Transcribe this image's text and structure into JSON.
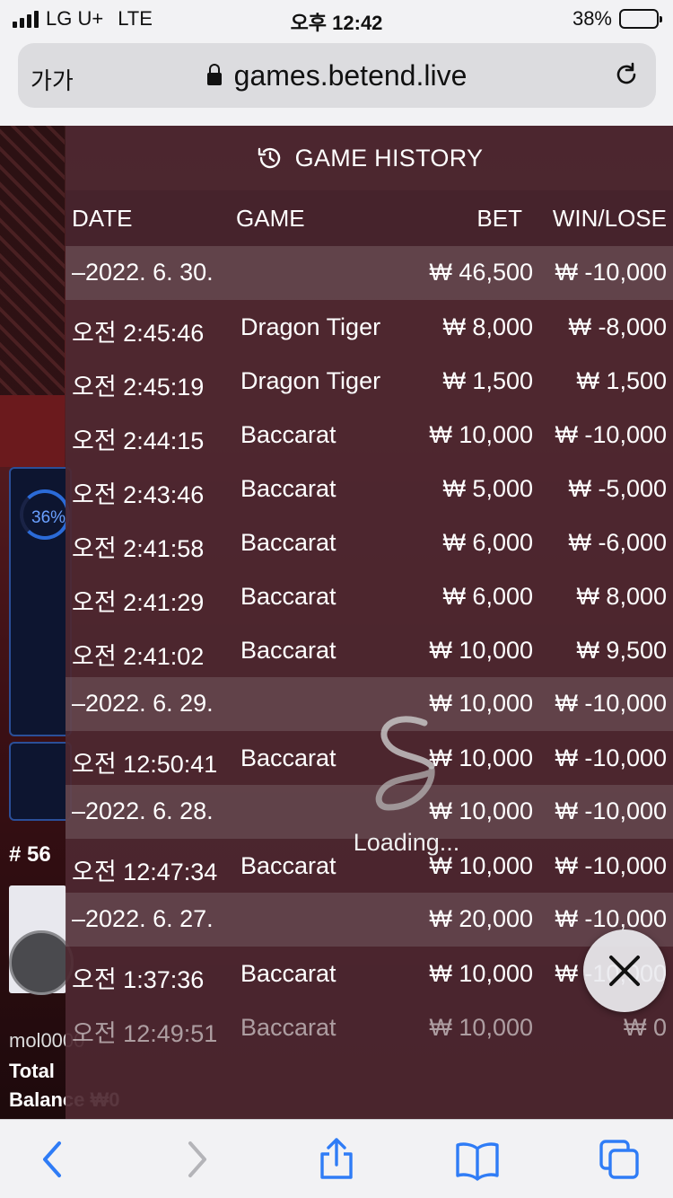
{
  "status_bar": {
    "carrier": "LG U+",
    "network": "LTE",
    "time": "오후 12:42",
    "battery": "38%",
    "battery_level": 0.38
  },
  "address_bar": {
    "text_size_label": "가가",
    "url": "games.betend.live"
  },
  "background": {
    "progress_label": "36%",
    "round_label": "# 56",
    "username": "mol0000",
    "total_label": "Total",
    "balance_label": "Balance ₩0"
  },
  "history": {
    "title": "GAME HISTORY",
    "columns": {
      "date": "DATE",
      "game": "GAME",
      "bet": "BET",
      "win_lose": "WIN/LOSE"
    },
    "rows": [
      {
        "type": "group",
        "date": "–2022. 6. 30.",
        "game": "",
        "bet": "₩ 46,500",
        "win_lose": "₩ -10,000"
      },
      {
        "type": "item",
        "date": "오전 2:45:46",
        "game": "Dragon Tiger",
        "bet": "₩ 8,000",
        "win_lose": "₩ -8,000"
      },
      {
        "type": "item",
        "date": "오전 2:45:19",
        "game": "Dragon Tiger",
        "bet": "₩ 1,500",
        "win_lose": "₩ 1,500"
      },
      {
        "type": "item",
        "date": "오전 2:44:15",
        "game": "Baccarat",
        "bet": "₩ 10,000",
        "win_lose": "₩ -10,000"
      },
      {
        "type": "item",
        "date": "오전 2:43:46",
        "game": "Baccarat",
        "bet": "₩ 5,000",
        "win_lose": "₩ -5,000"
      },
      {
        "type": "item",
        "date": "오전 2:41:58",
        "game": "Baccarat",
        "bet": "₩ 6,000",
        "win_lose": "₩ -6,000"
      },
      {
        "type": "item",
        "date": "오전 2:41:29",
        "game": "Baccarat",
        "bet": "₩ 6,000",
        "win_lose": "₩ 8,000"
      },
      {
        "type": "item",
        "date": "오전 2:41:02",
        "game": "Baccarat",
        "bet": "₩ 10,000",
        "win_lose": "₩ 9,500"
      },
      {
        "type": "group",
        "date": "–2022. 6. 29.",
        "game": "",
        "bet": "₩ 10,000",
        "win_lose": "₩ -10,000"
      },
      {
        "type": "item",
        "date": "오전 12:50:41",
        "game": "Baccarat",
        "bet": "₩ 10,000",
        "win_lose": "₩ -10,000"
      },
      {
        "type": "group",
        "date": "–2022. 6. 28.",
        "game": "",
        "bet": "₩ 10,000",
        "win_lose": "₩ -10,000"
      },
      {
        "type": "item",
        "date": "오전 12:47:34",
        "game": "Baccarat",
        "bet": "₩ 10,000",
        "win_lose": "₩ -10,000"
      },
      {
        "type": "group",
        "date": "–2022. 6. 27.",
        "game": "",
        "bet": "₩ 20,000",
        "win_lose": "₩ -10,000"
      },
      {
        "type": "item",
        "date": "오전 1:37:36",
        "game": "Baccarat",
        "bet": "₩ 10,000",
        "win_lose": "₩ -10,000"
      },
      {
        "type": "item",
        "date": "오전 12:49:51",
        "game": "Baccarat",
        "bet": "₩ 10,000",
        "win_lose": "₩ 0",
        "faded": true
      }
    ],
    "loading_text": "Loading..."
  },
  "colors": {
    "modal_bg": "#4e2830",
    "group_row_bg": "#7d6a70",
    "safari_blue": "#2f7cf6"
  }
}
